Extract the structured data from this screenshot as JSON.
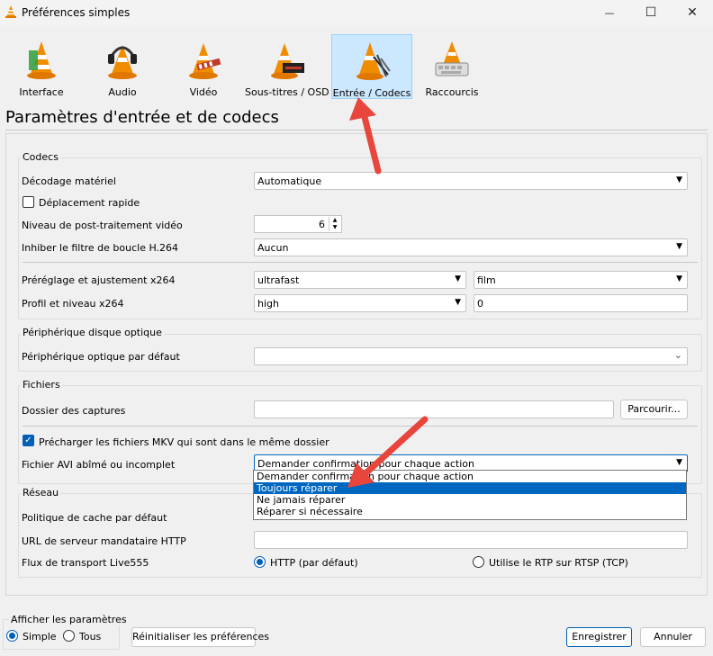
{
  "window": {
    "title": "Préférences simples",
    "minimize": "—",
    "maximize": "☐",
    "close": "✕"
  },
  "toolbar": {
    "items": [
      {
        "label": "Interface"
      },
      {
        "label": "Audio"
      },
      {
        "label": "Vidéo"
      },
      {
        "label": "Sous-titres / OSD"
      },
      {
        "label": "Entrée / Codecs",
        "selected": true
      },
      {
        "label": "Raccourcis"
      }
    ]
  },
  "page_title": "Paramètres d'entrée et de codecs",
  "codecs": {
    "title": "Codecs",
    "hw_decoding_label": "Décodage matériel",
    "hw_decoding_value": "Automatique",
    "fast_seek_label": "Déplacement rapide",
    "postproc_label": "Niveau de post-traitement vidéo",
    "postproc_value": "6",
    "loop_filter_label": "Inhiber le filtre de boucle H.264",
    "loop_filter_value": "Aucun",
    "x264_preset_label": "Préréglage et ajustement x264",
    "x264_preset_value": "ultrafast",
    "x264_tune_value": "film",
    "x264_profile_label": "Profil et niveau x264",
    "x264_profile_value": "high",
    "x264_level_value": "0"
  },
  "optical": {
    "title": "Périphérique disque optique",
    "default_label": "Périphérique optique par défaut",
    "default_value": ""
  },
  "files": {
    "title": "Fichiers",
    "captures_label": "Dossier des captures",
    "captures_value": "",
    "browse_label": "Parcourir...",
    "mkv_label": "Précharger les fichiers MKV qui sont dans le même dossier",
    "avi_label": "Fichier AVI abîmé ou incomplet",
    "avi_value": "Demander confirmation pour chaque action",
    "avi_options": [
      "Demander confirmation pour chaque action",
      "Toujours réparer",
      "Ne jamais réparer",
      "Réparer si nécessaire"
    ],
    "avi_highlighted_index": 1
  },
  "network": {
    "title": "Réseau",
    "cache_label": "Politique de cache par défaut",
    "proxy_label": "URL de serveur mandataire HTTP",
    "proxy_value": "",
    "live555_label": "Flux de transport Live555",
    "http_option": "HTTP (par défaut)",
    "rtp_option": "Utilise le RTP sur RTSP (TCP)"
  },
  "footer": {
    "show_settings_label": "Afficher les paramètres",
    "simple_label": "Simple",
    "all_label": "Tous",
    "reset_label": "Réinitialiser les préférences",
    "save_label": "Enregistrer",
    "cancel_label": "Annuler"
  },
  "colors": {
    "accent": "#0067c0",
    "annotation_arrow": "#e8453c",
    "selected_tab": "#cce8ff"
  }
}
